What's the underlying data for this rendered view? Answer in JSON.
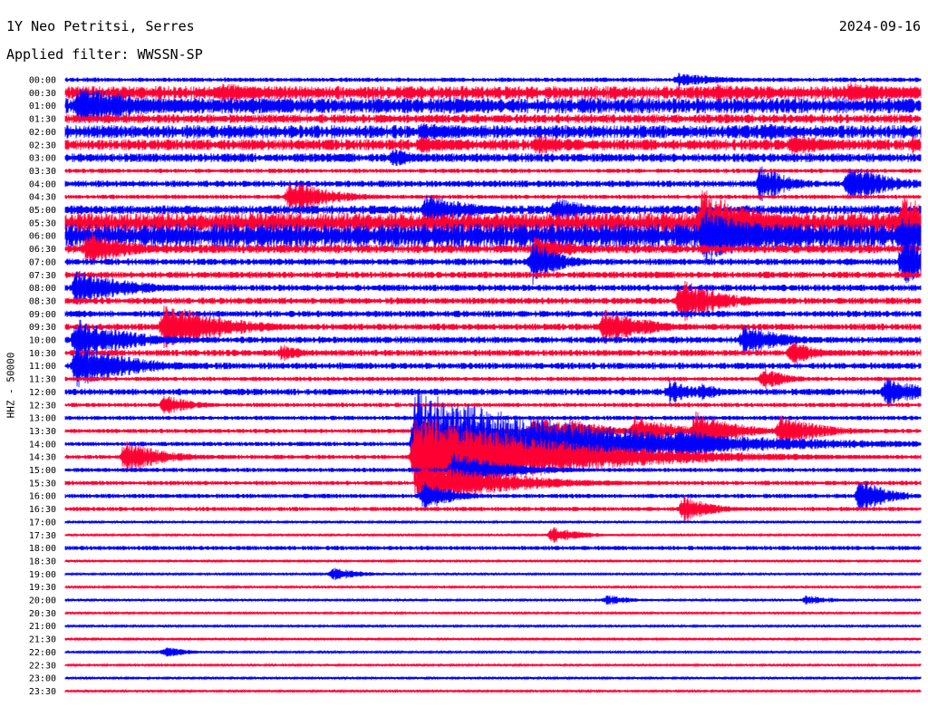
{
  "header": {
    "station": "1Y Neo Petritsi, Serres",
    "date": "2024-09-16",
    "filter_label": "Applied filter: WWSSN-SP"
  },
  "colors": {
    "odd_trace": "#0000ff",
    "even_trace": "#ff0033",
    "background": "#ffffff"
  },
  "chart_data": {
    "type": "line",
    "title": "1Y Neo Petritsi, Serres",
    "date": "2024-09-16",
    "filter": "WWSSN-SP",
    "ylabel": "HHZ - 50000",
    "rows": [
      "00:00",
      "00:30",
      "01:00",
      "01:30",
      "02:00",
      "02:30",
      "03:00",
      "03:30",
      "04:00",
      "04:30",
      "05:00",
      "05:30",
      "06:00",
      "06:30",
      "07:00",
      "07:30",
      "08:00",
      "08:30",
      "09:00",
      "09:30",
      "10:00",
      "10:30",
      "11:00",
      "11:30",
      "12:00",
      "12:30",
      "13:00",
      "13:30",
      "14:00",
      "14:30",
      "15:00",
      "15:30",
      "16:00",
      "16:30",
      "17:00",
      "17:30",
      "18:00",
      "18:30",
      "19:00",
      "19:30",
      "20:00",
      "20:30",
      "21:00",
      "21:30",
      "22:00",
      "22:30",
      "23:00",
      "23:30"
    ],
    "row_minutes": 30,
    "noise_levels": [
      2,
      6,
      7,
      4,
      6,
      5,
      4,
      2,
      3,
      2,
      4,
      9,
      11,
      4,
      3,
      3,
      3,
      3,
      3,
      3,
      3,
      3,
      3,
      2,
      3,
      2,
      2,
      2,
      2,
      2,
      2,
      2,
      2,
      2,
      1,
      1,
      2,
      1,
      1,
      1,
      1,
      1,
      1,
      1,
      1,
      1,
      1,
      1
    ],
    "events": [
      {
        "row": 0,
        "minute": 21.5,
        "amplitude": 8,
        "duration_min": 2
      },
      {
        "row": 1,
        "minute": 5.5,
        "amplitude": 12,
        "duration_min": 2
      },
      {
        "row": 1,
        "minute": 22.8,
        "amplitude": 10,
        "duration_min": 3
      },
      {
        "row": 1,
        "minute": 27.5,
        "amplitude": 12,
        "duration_min": 3
      },
      {
        "row": 2,
        "minute": 0.5,
        "amplitude": 22,
        "duration_min": 3
      },
      {
        "row": 2,
        "minute": 6.5,
        "amplitude": 10,
        "duration_min": 3
      },
      {
        "row": 2,
        "minute": 13.5,
        "amplitude": 10,
        "duration_min": 3
      },
      {
        "row": 4,
        "minute": 12.5,
        "amplitude": 10,
        "duration_min": 3
      },
      {
        "row": 4,
        "minute": 24.5,
        "amplitude": 10,
        "duration_min": 2
      },
      {
        "row": 5,
        "minute": 12.5,
        "amplitude": 10,
        "duration_min": 2
      },
      {
        "row": 5,
        "minute": 16.5,
        "amplitude": 12,
        "duration_min": 2
      },
      {
        "row": 5,
        "minute": 25.5,
        "amplitude": 12,
        "duration_min": 2
      },
      {
        "row": 5,
        "minute": 29.7,
        "amplitude": 10,
        "duration_min": 1.5
      },
      {
        "row": 6,
        "minute": 11.5,
        "amplitude": 10,
        "duration_min": 1.5
      },
      {
        "row": 8,
        "minute": 24.4,
        "amplitude": 22,
        "duration_min": 1
      },
      {
        "row": 8,
        "minute": 27.5,
        "amplitude": 22,
        "duration_min": 1.5
      },
      {
        "row": 9,
        "minute": 7.9,
        "amplitude": 20,
        "duration_min": 1.5
      },
      {
        "row": 10,
        "minute": 12.7,
        "amplitude": 20,
        "duration_min": 1.5
      },
      {
        "row": 10,
        "minute": 17.2,
        "amplitude": 14,
        "duration_min": 1.5
      },
      {
        "row": 11,
        "minute": 22.3,
        "amplitude": 40,
        "duration_min": 2
      },
      {
        "row": 11,
        "minute": 29.4,
        "amplitude": 30,
        "duration_min": 2.5
      },
      {
        "row": 12,
        "minute": 22.4,
        "amplitude": 30,
        "duration_min": 3
      },
      {
        "row": 12,
        "minute": 29.3,
        "amplitude": 22,
        "duration_min": 2
      },
      {
        "row": 13,
        "minute": 16.5,
        "amplitude": 16,
        "duration_min": 1.5
      },
      {
        "row": 13,
        "minute": 0.8,
        "amplitude": 20,
        "duration_min": 1.5
      },
      {
        "row": 14,
        "minute": 16.4,
        "amplitude": 26,
        "duration_min": 1
      },
      {
        "row": 14,
        "minute": 29.4,
        "amplitude": 30,
        "duration_min": 1
      },
      {
        "row": 16,
        "minute": 0.4,
        "amplitude": 20,
        "duration_min": 2
      },
      {
        "row": 17,
        "minute": 21.6,
        "amplitude": 25,
        "duration_min": 1.5
      },
      {
        "row": 19,
        "minute": 3.5,
        "amplitude": 30,
        "duration_min": 2
      },
      {
        "row": 19,
        "minute": 18.9,
        "amplitude": 20,
        "duration_min": 1.5
      },
      {
        "row": 19,
        "minute": 20.3,
        "amplitude": 10,
        "duration_min": 1
      },
      {
        "row": 20,
        "minute": 0.4,
        "amplitude": 24,
        "duration_min": 2
      },
      {
        "row": 20,
        "minute": 23.8,
        "amplitude": 18,
        "duration_min": 1.5
      },
      {
        "row": 21,
        "minute": 7.6,
        "amplitude": 10,
        "duration_min": 1
      },
      {
        "row": 21,
        "minute": 25.5,
        "amplitude": 14,
        "duration_min": 1
      },
      {
        "row": 22,
        "minute": 0.4,
        "amplitude": 26,
        "duration_min": 2
      },
      {
        "row": 23,
        "minute": 24.5,
        "amplitude": 12,
        "duration_min": 1
      },
      {
        "row": 24,
        "minute": 21.2,
        "amplitude": 14,
        "duration_min": 1
      },
      {
        "row": 24,
        "minute": 22.3,
        "amplitude": 10,
        "duration_min": 1
      },
      {
        "row": 24,
        "minute": 28.8,
        "amplitude": 16,
        "duration_min": 1.5
      },
      {
        "row": 25,
        "minute": 3.5,
        "amplitude": 12,
        "duration_min": 1
      },
      {
        "row": 27,
        "minute": 16.4,
        "amplitude": 18,
        "duration_min": 1.5
      },
      {
        "row": 27,
        "minute": 17.7,
        "amplitude": 14,
        "duration_min": 1.5
      },
      {
        "row": 27,
        "minute": 20.0,
        "amplitude": 18,
        "duration_min": 1.5
      },
      {
        "row": 27,
        "minute": 22.1,
        "amplitude": 22,
        "duration_min": 1.5
      },
      {
        "row": 27,
        "minute": 25.1,
        "amplitude": 18,
        "duration_min": 1.5
      },
      {
        "row": 28,
        "minute": 12.3,
        "amplitude": 60,
        "duration_min": 6
      },
      {
        "row": 28,
        "minute": 21.5,
        "amplitude": 22,
        "duration_min": 1.5
      },
      {
        "row": 29,
        "minute": 2.1,
        "amplitude": 18,
        "duration_min": 1.5
      },
      {
        "row": 29,
        "minute": 12.3,
        "amplitude": 50,
        "duration_min": 5
      },
      {
        "row": 30,
        "minute": 13.6,
        "amplitude": 20,
        "duration_min": 2
      },
      {
        "row": 31,
        "minute": 12.5,
        "amplitude": 26,
        "duration_min": 3
      },
      {
        "row": 32,
        "minute": 12.6,
        "amplitude": 18,
        "duration_min": 1
      },
      {
        "row": 32,
        "minute": 27.9,
        "amplitude": 20,
        "duration_min": 1
      },
      {
        "row": 33,
        "minute": 21.7,
        "amplitude": 16,
        "duration_min": 1
      },
      {
        "row": 35,
        "minute": 17.1,
        "amplitude": 10,
        "duration_min": 1
      },
      {
        "row": 38,
        "minute": 9.4,
        "amplitude": 8,
        "duration_min": 1
      },
      {
        "row": 40,
        "minute": 19.0,
        "amplitude": 6,
        "duration_min": 1
      },
      {
        "row": 40,
        "minute": 26.0,
        "amplitude": 6,
        "duration_min": 1
      },
      {
        "row": 44,
        "minute": 3.5,
        "amplitude": 6,
        "duration_min": 1
      }
    ]
  }
}
